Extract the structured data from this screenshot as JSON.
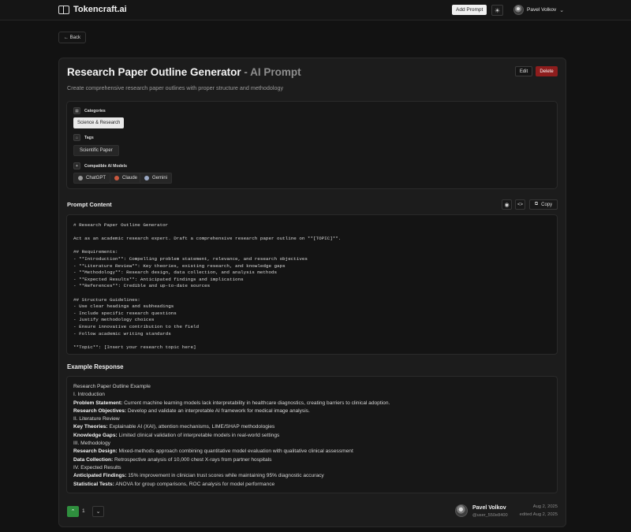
{
  "header": {
    "brand": "Tokencraft.ai",
    "add_prompt": "Add Prompt",
    "user_name": "Pavel Volkov"
  },
  "back_label": "← Back",
  "prompt": {
    "title": "Research Paper Outline Generator",
    "title_suffix": " - AI Prompt",
    "description": "Create comprehensive research paper outlines with proper structure and methodology",
    "edit_label": "Edit",
    "delete_label": "Delete"
  },
  "meta": {
    "categories_label": "Categories",
    "categories": [
      "Science & Research"
    ],
    "tags_label": "Tags",
    "tags": [
      "Scientific Paper"
    ],
    "models_label": "Compatible AI Models",
    "models": [
      {
        "name": "ChatGPT",
        "color": "#9a9a9a"
      },
      {
        "name": "Claude",
        "color": "#c9583f"
      },
      {
        "name": "Gemini",
        "color": "#9aa8c4"
      }
    ]
  },
  "content": {
    "section_title": "Prompt Content",
    "copy_label": "Copy",
    "lines": [
      "# Research Paper Outline Generator",
      "",
      "Act as an academic research expert. Draft a comprehensive research paper outline on **[TOPIC]**.",
      "",
      "## Requirements:",
      "- **Introduction**: Compelling problem statement, relevance, and research objectives",
      "- **Literature Review**: Key theories, existing research, and knowledge gaps",
      "- **Methodology**: Research design, data collection, and analysis methods",
      "- **Expected Results**: Anticipated findings and implications",
      "- **References**: Credible and up-to-date sources",
      "",
      "## Structure Guidelines:",
      "- Use clear headings and subheadings",
      "- Include specific research questions",
      "- Justify methodology choices",
      "- Ensure innovative contribution to the field",
      "- Follow academic writing standards",
      "",
      "**Topic**: [Insert your research topic here]"
    ]
  },
  "example": {
    "section_title": "Example Response",
    "lines": [
      {
        "bold": "",
        "text": "Research Paper Outline Example"
      },
      {
        "bold": "",
        "text": "I. Introduction"
      },
      {
        "bold": "Problem Statement:",
        "text": " Current machine learning models lack interpretability in healthcare diagnostics, creating barriers to clinical adoption."
      },
      {
        "bold": "Research Objectives:",
        "text": " Develop and validate an interpretable AI framework for medical image analysis."
      },
      {
        "bold": "",
        "text": "II. Literature Review"
      },
      {
        "bold": "Key Theories:",
        "text": " Explainable AI (XAI), attention mechanisms, LIME/SHAP methodologies"
      },
      {
        "bold": "Knowledge Gaps:",
        "text": " Limited clinical validation of interpretable models in real-world settings"
      },
      {
        "bold": "",
        "text": "III. Methodology"
      },
      {
        "bold": "Research Design:",
        "text": " Mixed-methods approach combining quantitative model evaluation with qualitative clinical assessment"
      },
      {
        "bold": "Data Collection:",
        "text": " Retrospective analysis of 10,000 chest X-rays from partner hospitals"
      },
      {
        "bold": "",
        "text": "IV. Expected Results"
      },
      {
        "bold": "Anticipated Findings:",
        "text": " 15% improvement in clinician trust scores while maintaining 95% diagnostic accuracy"
      },
      {
        "bold": "Statistical Tests:",
        "text": " ANOVA for group comparisons, ROC analysis for model performance"
      }
    ]
  },
  "footer": {
    "vote_count": "1",
    "author_name": "Pavel Volkov",
    "author_handle": "@user_550e8400",
    "created": "Aug 2, 2025",
    "edited": "edited Aug 2, 2025"
  }
}
